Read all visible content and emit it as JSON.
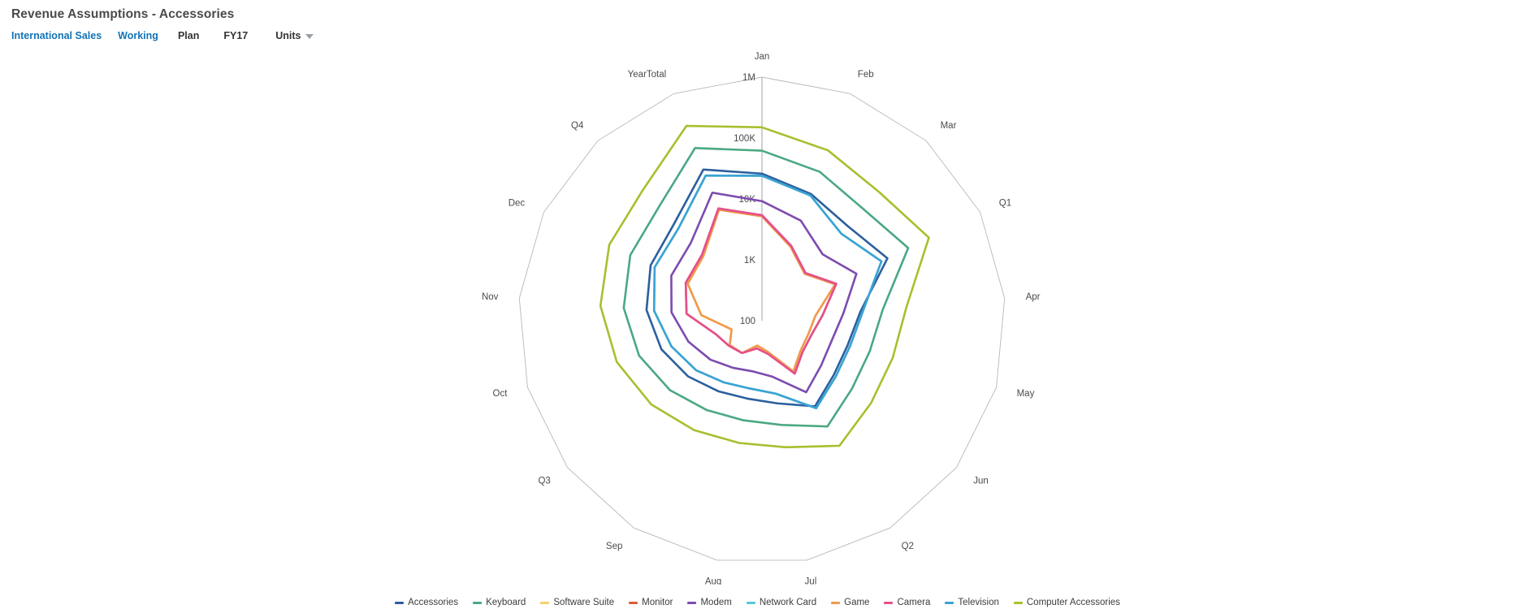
{
  "header": {
    "title": "Revenue Assumptions - Accessories",
    "breadcrumb": [
      {
        "label": "International Sales",
        "style": "link"
      },
      {
        "label": "Working",
        "style": "link"
      },
      {
        "label": "Plan",
        "style": "plain"
      },
      {
        "label": "FY17",
        "style": "plain"
      },
      {
        "label": "Units",
        "style": "dropdown",
        "icon": "chevron-down-icon"
      }
    ]
  },
  "chart_data": {
    "type": "radar",
    "title": "Revenue Assumptions - Accessories",
    "scale": "log",
    "ylim": [
      100,
      1000000
    ],
    "grid": true,
    "legend_position": "bottom",
    "radial_ticks": [
      {
        "label": "100",
        "value": 100
      },
      {
        "label": "1K",
        "value": 1000
      },
      {
        "label": "10K",
        "value": 10000
      },
      {
        "label": "100K",
        "value": 100000
      },
      {
        "label": "1M",
        "value": 1000000
      }
    ],
    "categories": [
      "Jan",
      "Feb",
      "Mar",
      "Q1",
      "Apr",
      "May",
      "Jun",
      "Q2",
      "Jul",
      "Aug",
      "Sep",
      "Q3",
      "Oct",
      "Nov",
      "Dec",
      "Q4",
      "YearTotal"
    ],
    "series": [
      {
        "name": "Accessories",
        "color": "#2b5f9e",
        "values": [
          26000,
          17000,
          12500,
          20000,
          4200,
          2900,
          3000,
          4500,
          2400,
          2000,
          2300,
          3300,
          5200,
          8000,
          11000,
          14000,
          46000
        ]
      },
      {
        "name": "Keyboard",
        "color": "#4aa882",
        "values": [
          62000,
          42000,
          30000,
          48000,
          9800,
          6900,
          7100,
          11000,
          5500,
          4600,
          5300,
          7800,
          12500,
          19000,
          26000,
          33000,
          110000
        ]
      },
      {
        "name": "Software Suite",
        "color": "#f4cf6b",
        "values": [
          5200,
          2000,
          1100,
          2200,
          760,
          620,
          630,
          950,
          330,
          260,
          420,
          460,
          330,
          1000,
          2300,
          2700,
          9000
        ]
      },
      {
        "name": "Monitor",
        "color": "#e05a3a",
        "values": [
          5400,
          2100,
          1150,
          2300,
          1000,
          700,
          690,
          1050,
          360,
          290,
          420,
          480,
          620,
          1750,
          2500,
          2900,
          9500
        ]
      },
      {
        "name": "Modem",
        "color": "#7c4bb0",
        "values": [
          9200,
          5800,
          3000,
          5400,
          2200,
          1550,
          1650,
          2400,
          860,
          700,
          810,
          1150,
          1800,
          3100,
          4600,
          5400,
          18000
        ]
      },
      {
        "name": "Network Card",
        "color": "#58c6d9",
        "values": [
          24000,
          16000,
          8600,
          15500,
          4600,
          3200,
          3300,
          4900,
          1650,
          1350,
          1550,
          2250,
          3500,
          6000,
          9300,
          11000,
          36000
        ]
      },
      {
        "name": "Game",
        "color": "#ef9a4d",
        "values": [
          5200,
          2000,
          1100,
          2200,
          760,
          620,
          630,
          950,
          330,
          260,
          420,
          460,
          330,
          1000,
          2300,
          2700,
          9000
        ]
      },
      {
        "name": "Camera",
        "color": "#e4508c",
        "values": [
          5400,
          2100,
          1150,
          2300,
          1000,
          700,
          690,
          1050,
          360,
          290,
          420,
          480,
          620,
          1750,
          2500,
          2900,
          9500
        ]
      },
      {
        "name": "Television",
        "color": "#3aa3d4",
        "values": [
          24000,
          16000,
          8600,
          15500,
          4600,
          3200,
          3300,
          4900,
          1650,
          1350,
          1550,
          2250,
          3500,
          6000,
          9300,
          11000,
          36000
        ]
      },
      {
        "name": "Computer Accessories",
        "color": "#a8bf2e",
        "values": [
          150000,
          100000,
          72000,
          115000,
          24000,
          17000,
          17500,
          26000,
          13000,
          11000,
          13000,
          19000,
          30000,
          46000,
          63000,
          80000,
          270000
        ]
      }
    ]
  }
}
